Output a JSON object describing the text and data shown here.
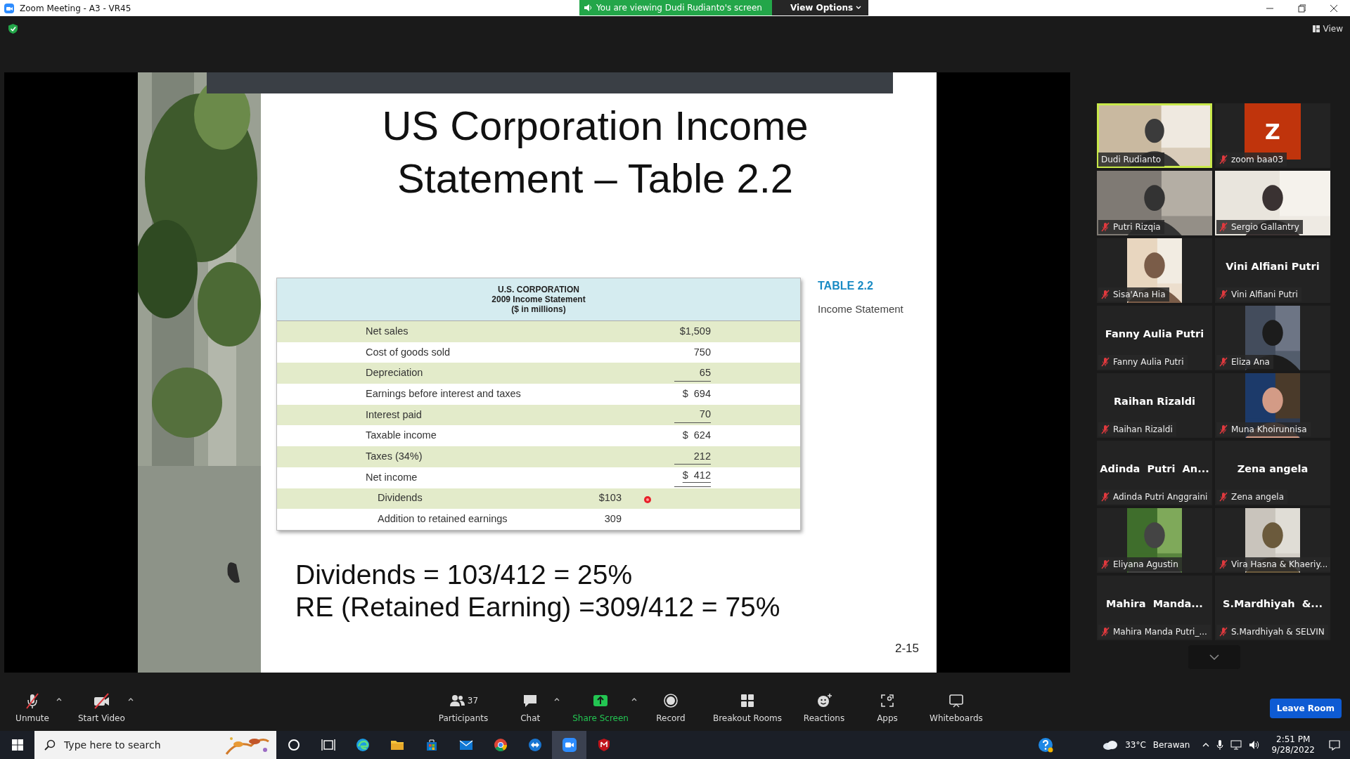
{
  "window": {
    "title": "Zoom Meeting - A3 - VR45"
  },
  "share_banner": {
    "text": "You are viewing Dudi Rudianto's screen",
    "view_options": "View Options"
  },
  "view_button": "View",
  "slide": {
    "title_lines": [
      "US Corporation Income",
      "Statement – Table 2.2"
    ],
    "table": {
      "heading": [
        "U.S. CORPORATION",
        "2009 Income Statement",
        "($ in millions)"
      ],
      "rows": [
        {
          "kind": "main",
          "label": "Net sales",
          "amount": "$1,509",
          "underlined": false,
          "double": false
        },
        {
          "kind": "main",
          "label": "Cost of goods sold",
          "amount": "750",
          "underlined": false,
          "double": false
        },
        {
          "kind": "main",
          "label": "Depreciation",
          "amount": "65",
          "underlined": true,
          "double": false
        },
        {
          "kind": "main",
          "label": "Earnings before interest and taxes",
          "amount": "$  694",
          "underlined": false,
          "double": false
        },
        {
          "kind": "main",
          "label": "Interest paid",
          "amount": "70",
          "underlined": true,
          "double": false
        },
        {
          "kind": "main",
          "label": "Taxable income",
          "amount": "$  624",
          "underlined": false,
          "double": false
        },
        {
          "kind": "main",
          "label": "Taxes (34%)",
          "amount": "212",
          "underlined": true,
          "double": false
        },
        {
          "kind": "main",
          "label": "Net income",
          "amount": "$  412",
          "underlined": true,
          "double": true
        },
        {
          "kind": "sub",
          "label": "Dividends",
          "amount": "$103",
          "underlined": false,
          "double": false
        },
        {
          "kind": "sub",
          "label": "Addition to retained earnings",
          "amount": "309",
          "underlined": false,
          "double": false
        }
      ]
    },
    "caption": {
      "label": "TABLE 2.2",
      "text": "Income Statement"
    },
    "lines": [
      "Dividends = 103/412 = 25%",
      "RE (Retained Earning) =309/412 = 75%"
    ],
    "page": "2-15"
  },
  "participants": [
    {
      "kind": "video",
      "name": "Dudi Rudianto",
      "muted": false,
      "speaking": true
    },
    {
      "kind": "avatar",
      "initial": "Z",
      "name": "zoom baa03",
      "muted": true,
      "speaking": false
    },
    {
      "kind": "video",
      "name": "Putri Rizqia",
      "muted": true,
      "speaking": false
    },
    {
      "kind": "video",
      "name": "Sergio Gallantry",
      "muted": true,
      "speaking": false
    },
    {
      "kind": "portrait",
      "name": "Sisa'Ana Hia",
      "muted": true,
      "speaking": false
    },
    {
      "kind": "name",
      "display_name": "Vini Alfiani Putri",
      "name": "Vini Alfiani Putri",
      "muted": true,
      "speaking": false
    },
    {
      "kind": "name",
      "display_name": "Fanny Aulia Putri",
      "name": "Fanny Aulia Putri",
      "muted": true,
      "speaking": false
    },
    {
      "kind": "portrait",
      "name": "Eliza Ana",
      "muted": true,
      "speaking": false
    },
    {
      "kind": "name",
      "display_name": "Raihan Rizaldi",
      "name": "Raihan Rizaldi",
      "muted": true,
      "speaking": false
    },
    {
      "kind": "portrait",
      "name": "Muna Khoirunnisa",
      "muted": true,
      "speaking": false
    },
    {
      "kind": "name",
      "display_name": "Adinda  Putri  An...",
      "name": "Adinda Putri Anggraini",
      "muted": true,
      "speaking": false
    },
    {
      "kind": "name",
      "display_name": "Zena angela",
      "name": "Zena angela",
      "muted": true,
      "speaking": false
    },
    {
      "kind": "portrait",
      "name": "Eliyana Agustin",
      "muted": true,
      "speaking": false
    },
    {
      "kind": "portrait",
      "name": "Vira Hasna & Khaeriy...",
      "muted": true,
      "speaking": false
    },
    {
      "kind": "name",
      "display_name": "Mahira  Manda...",
      "name": "Mahira Manda Putri_...",
      "muted": true,
      "speaking": false
    },
    {
      "kind": "name",
      "display_name": "S.Mardhiyah  &...",
      "name": "S.Mardhiyah & SELVIN",
      "muted": true,
      "speaking": false
    }
  ],
  "toolbar": {
    "left": [
      {
        "kind": "mic",
        "label": "Unmute",
        "caret": true
      },
      {
        "kind": "camera",
        "label": "Start Video",
        "caret": true
      }
    ],
    "center": [
      {
        "kind": "participants",
        "label": "Participants",
        "count": "37",
        "caret": false
      },
      {
        "kind": "chat",
        "label": "Chat",
        "caret": true
      },
      {
        "kind": "share",
        "label": "Share Screen",
        "caret": true
      },
      {
        "kind": "record",
        "label": "Record",
        "caret": false
      },
      {
        "kind": "breakout",
        "label": "Breakout Rooms",
        "caret": false
      },
      {
        "kind": "reactions",
        "label": "Reactions",
        "caret": false
      },
      {
        "kind": "apps",
        "label": "Apps",
        "caret": false
      },
      {
        "kind": "whiteboard",
        "label": "Whiteboards",
        "caret": false
      }
    ],
    "leave": "Leave Room"
  },
  "taskbar": {
    "search_placeholder": "Type here to search",
    "apps": [
      {
        "kind": "cortana",
        "active": false
      },
      {
        "kind": "taskview",
        "active": false
      },
      {
        "kind": "edge",
        "active": false
      },
      {
        "kind": "explorer",
        "active": false
      },
      {
        "kind": "store",
        "active": false
      },
      {
        "kind": "mail",
        "active": false
      },
      {
        "kind": "chrome",
        "active": false
      },
      {
        "kind": "remote",
        "active": false
      },
      {
        "kind": "zoom",
        "active": true
      },
      {
        "kind": "shield",
        "active": false
      }
    ],
    "weather": {
      "temp": "33°C",
      "condition": "Berawan"
    },
    "time": "2:51 PM",
    "date": "9/28/2022"
  }
}
